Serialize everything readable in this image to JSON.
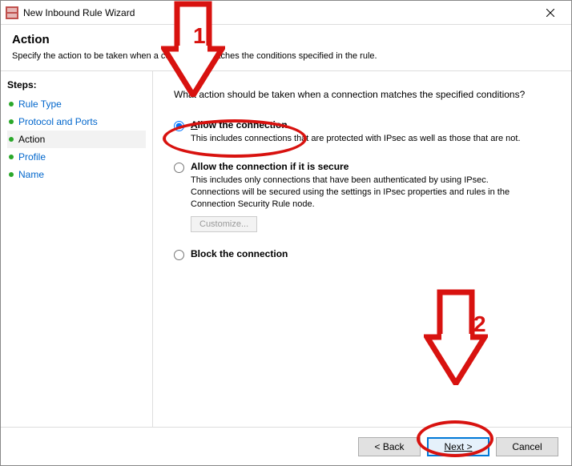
{
  "window": {
    "title": "New Inbound Rule Wizard"
  },
  "header": {
    "title": "Action",
    "subtitle": "Specify the action to be taken when a connection matches the conditions specified in the rule."
  },
  "sidebar": {
    "label": "Steps:",
    "items": [
      {
        "label": "Rule Type"
      },
      {
        "label": "Protocol and Ports"
      },
      {
        "label": "Action"
      },
      {
        "label": "Profile"
      },
      {
        "label": "Name"
      }
    ]
  },
  "main": {
    "prompt": "What action should be taken when a connection matches the specified conditions?",
    "options": {
      "allow": {
        "label": "Allow the connection",
        "desc": "This includes connections that are protected with IPsec as well as those that are not."
      },
      "allow_secure": {
        "label": "Allow the connection if it is secure",
        "desc": "This includes only connections that have been authenticated by using IPsec. Connections will be secured using the settings in IPsec properties and rules in the Connection Security Rule node.",
        "customize": "Customize..."
      },
      "block": {
        "label": "Block the connection"
      }
    }
  },
  "footer": {
    "back": "< Back",
    "next": "Next >",
    "cancel": "Cancel"
  },
  "annotations": {
    "one": "1",
    "two": "2"
  }
}
